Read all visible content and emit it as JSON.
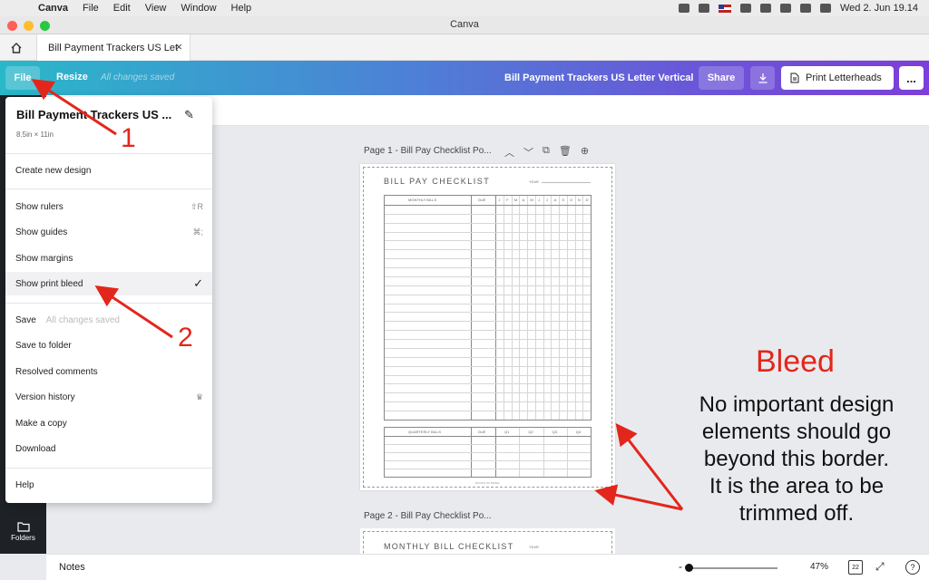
{
  "menubar": {
    "app": "Canva",
    "items": [
      "File",
      "Edit",
      "View",
      "Window",
      "Help"
    ],
    "clock": "Wed 2. Jun  19.14"
  },
  "window": {
    "title": "Canva"
  },
  "tab": {
    "label": "Bill Payment Trackers US Let"
  },
  "toolbar": {
    "file_label": "File",
    "resize_label": "Resize",
    "saved_status": "All changes saved",
    "document_title": "Bill Payment Trackers US Letter Vertical",
    "share_label": "Share",
    "print_label": "Print Letterheads",
    "more_label": "..."
  },
  "filemenu": {
    "title": "Bill Payment Trackers US ...",
    "size": "8.5in × 11in",
    "create": "Create new design",
    "items": [
      {
        "label": "Show rulers",
        "shortcut": "⇧R"
      },
      {
        "label": "Show guides",
        "shortcut": "⌘;"
      },
      {
        "label": "Show margins",
        "shortcut": ""
      },
      {
        "label": "Show print bleed",
        "shortcut": "✓"
      }
    ],
    "save_label": "Save",
    "save_status": "All changes saved",
    "save_to_folder": "Save to folder",
    "resolved_comments": "Resolved comments",
    "version_history": "Version history",
    "make_copy": "Make a copy",
    "download": "Download",
    "help": "Help"
  },
  "pages": [
    {
      "label": "Page 1 - Bill Pay Checklist Po...",
      "heading": "BILL PAY CHECKLIST",
      "year_label": "YEAR",
      "monthly_header": "MONTHLY BILLS",
      "due_header": "DUE",
      "months": [
        "J",
        "F",
        "M",
        "A",
        "M",
        "J",
        "J",
        "A",
        "S",
        "O",
        "N",
        "D"
      ],
      "quarterly_header": "QUARTERLY BILLS",
      "quarters": [
        "Q1",
        "Q2",
        "Q3",
        "Q4"
      ],
      "footer": "BOOKS OF PAPER"
    },
    {
      "label": "Page 2 - Bill Pay Checklist Po...",
      "heading": "MONTHLY BILL CHECKLIST",
      "year_label": "YEAR"
    }
  ],
  "sidebar": {
    "folders_label": "Folders"
  },
  "bottombar": {
    "notes_label": "Notes",
    "zoom": "47%",
    "page_count": "22"
  },
  "annotations": {
    "marker_1": "1",
    "marker_2": "2",
    "bleed_title": "Bleed",
    "bleed_lines": [
      "No important design",
      "elements should go",
      "beyond this border.",
      "It is the area to be",
      "trimmed off."
    ],
    "color": "#e3261b"
  }
}
